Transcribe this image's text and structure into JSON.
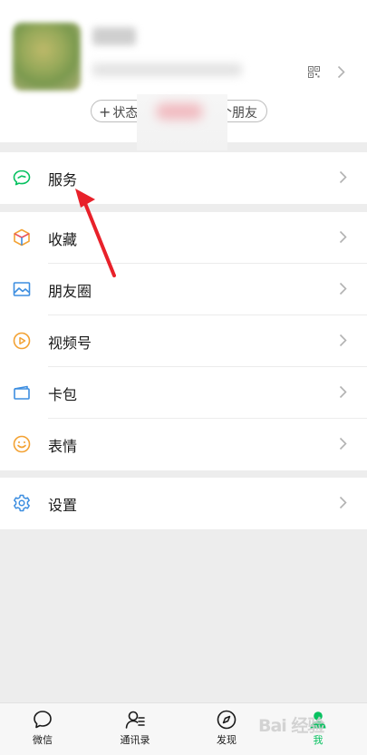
{
  "profile": {
    "status_button": "状态",
    "status_suffix": "个朋友"
  },
  "menu_groups": [
    {
      "items": [
        {
          "label": "服务",
          "icon": "service-icon"
        }
      ]
    },
    {
      "items": [
        {
          "label": "收藏",
          "icon": "favorites-cube-icon"
        },
        {
          "label": "朋友圈",
          "icon": "moments-image-icon"
        },
        {
          "label": "视频号",
          "icon": "channels-play-icon"
        },
        {
          "label": "卡包",
          "icon": "card-wallet-icon"
        },
        {
          "label": "表情",
          "icon": "sticker-smile-icon"
        }
      ]
    },
    {
      "items": [
        {
          "label": "设置",
          "icon": "settings-gear-icon"
        }
      ]
    }
  ],
  "tabbar": {
    "tabs": [
      {
        "label": "微信",
        "icon": "chat-bubble-icon"
      },
      {
        "label": "通讯录",
        "icon": "contacts-icon"
      },
      {
        "label": "发现",
        "icon": "discover-compass-icon"
      },
      {
        "label": "我",
        "icon": "me-person-icon",
        "active": true
      }
    ]
  },
  "watermark": "Bai 经验",
  "colors": {
    "accent_green": "#07c160",
    "service_green": "#07c160",
    "annotation_red": "#e8212a"
  }
}
